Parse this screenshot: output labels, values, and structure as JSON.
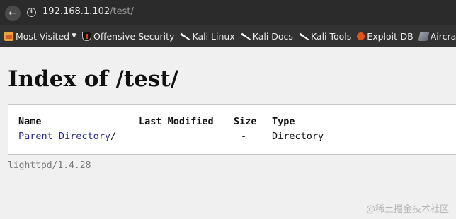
{
  "browser": {
    "url_host": "192.168.1.102",
    "url_path": "/test/"
  },
  "bookmarks": [
    {
      "label": "Most Visited",
      "icon": "folder-icon",
      "has_menu": true
    },
    {
      "label": "Offensive Security",
      "icon": "offsec-shield-icon"
    },
    {
      "label": "Kali Linux",
      "icon": "kali-dragon-icon"
    },
    {
      "label": "Kali Docs",
      "icon": "kali-dragon-icon"
    },
    {
      "label": "Kali Tools",
      "icon": "kali-dragon-icon"
    },
    {
      "label": "Exploit-DB",
      "icon": "exploit-db-icon"
    },
    {
      "label": "Aircrack-ng",
      "icon": "aircrack-icon"
    }
  ],
  "page": {
    "title": "Index of /test/",
    "columns": [
      "Name",
      "Last Modified",
      "Size",
      "Type"
    ],
    "rows": [
      {
        "name": "Parent Directory",
        "suffix": "/",
        "modified": "",
        "size": "-",
        "type": "Directory"
      }
    ],
    "footer": "lighttpd/1.4.28"
  },
  "watermark": "@稀土掘金技术社区"
}
